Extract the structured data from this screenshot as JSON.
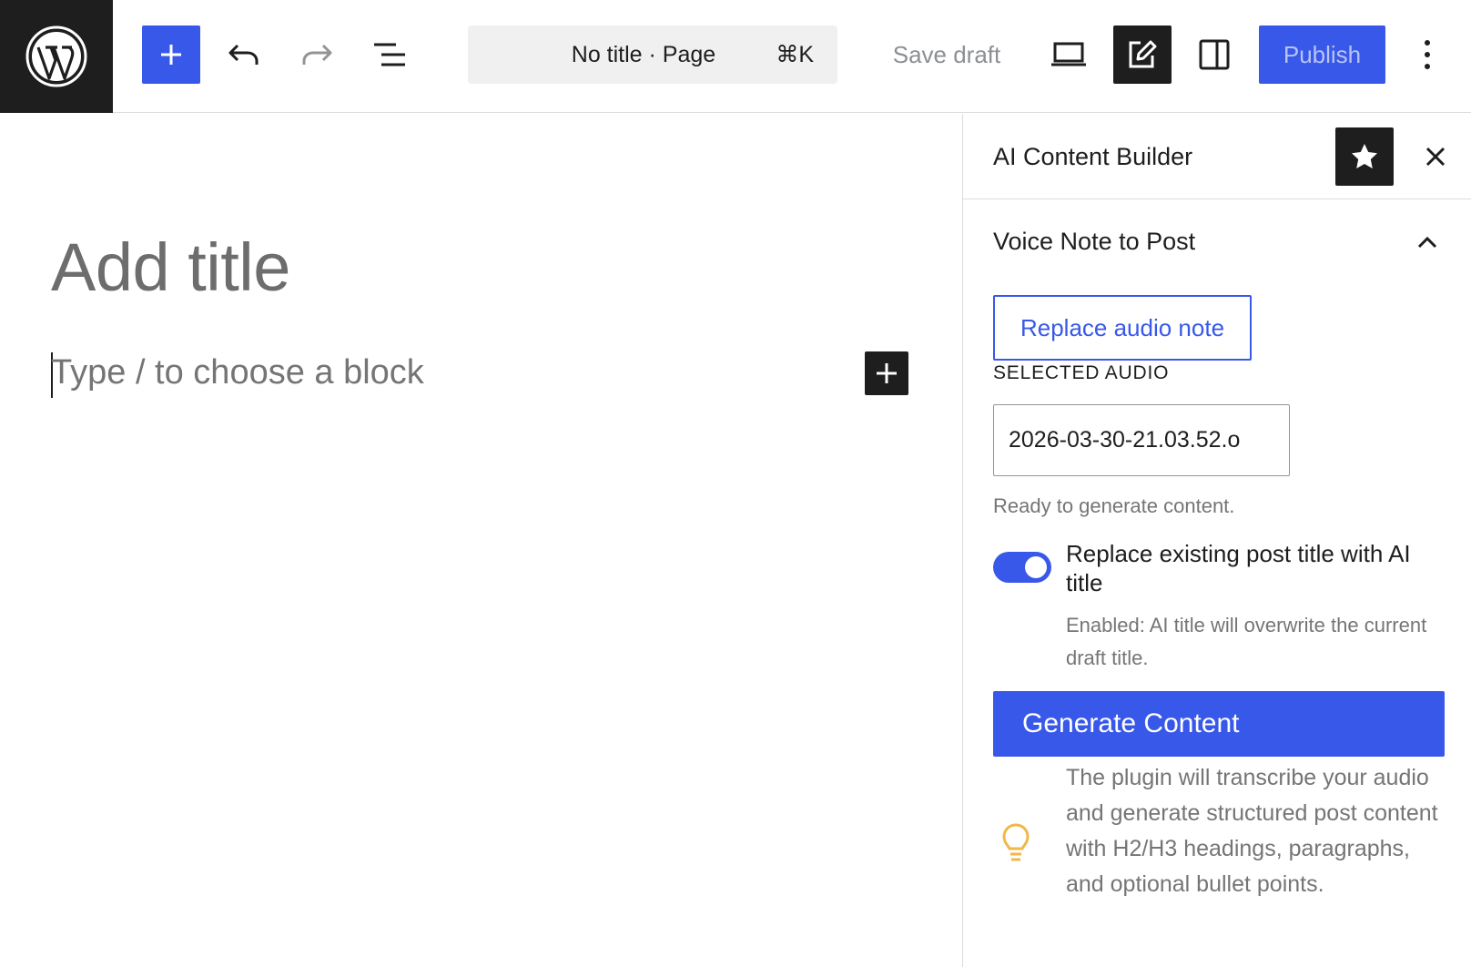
{
  "topbar": {
    "command_title": "No title · Page",
    "command_shortcut": "⌘K",
    "save_draft_label": "Save draft",
    "publish_label": "Publish"
  },
  "editor": {
    "title_placeholder": "Add title",
    "block_placeholder": "Type / to choose a block"
  },
  "sidebar": {
    "title": "AI Content Builder",
    "panel": {
      "title": "Voice Note to Post",
      "replace_button_label": "Replace audio note",
      "selected_label": "SELECTED AUDIO",
      "selected_audio_value": "2026-03-30-21.03.52.o",
      "status": "Ready to generate content.",
      "toggle_label": "Replace existing post title with AI title",
      "toggle_on": true,
      "toggle_help": "Enabled: AI title will overwrite the current draft title.",
      "generate_label": "Generate Content",
      "tip": "The plugin will transcribe your audio and generate structured post content with H2/H3 headings, paragraphs, and optional bullet points."
    }
  },
  "colors": {
    "accent": "#3858e9",
    "dark": "#1e1e1e",
    "muted": "#757575",
    "tip_icon": "#f0b849"
  },
  "icons": [
    "wordpress-logo-icon",
    "plus-icon",
    "undo-icon",
    "redo-icon",
    "list-view-icon",
    "desktop-preview-icon",
    "edit-tools-icon",
    "sidebar-toggle-icon",
    "more-vertical-icon",
    "star-icon",
    "close-icon",
    "chevron-up-icon",
    "lightbulb-icon"
  ]
}
